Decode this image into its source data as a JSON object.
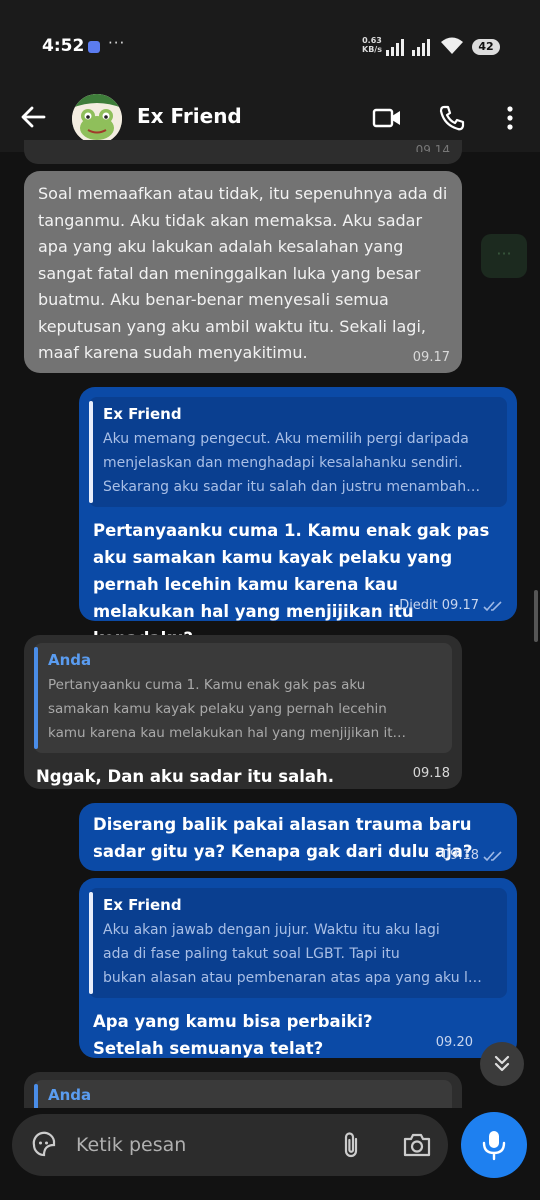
{
  "status_bar": {
    "time": "4:52",
    "more": "···",
    "net_speed_value": "0.63",
    "net_speed_unit": "KB/s",
    "battery": "42"
  },
  "header": {
    "contact_name": "Ex Friend"
  },
  "messages": {
    "top_partial_time": "09.14",
    "m1": {
      "text": "Soal memaafkan atau tidak, itu sepenuhnya ada di tanganmu. Aku tidak akan memaksa. Aku sadar apa yang aku lakukan adalah kesalahan yang sangat fatal dan meninggalkan luka yang besar buatmu. Aku benar-benar menyesali semua keputusan yang aku ambil waktu itu. Sekali lagi, maaf karena sudah menyakitimu.",
      "time": "09.17"
    },
    "m2": {
      "quote_name": "Ex Friend",
      "quote_lines": [
        "Aku memang pengecut. Aku memilih pergi daripada",
        "menjelaskan dan menghadapi kesalahanku sendiri.",
        "Sekarang aku sadar itu salah dan justru menambah…"
      ],
      "text": "Pertanyaanku cuma 1. Kamu enak gak pas aku samakan kamu kayak pelaku yang pernah lecehin kamu karena kau melakukan hal yang menjijikan itu kepadaku?",
      "edited": "Diedit",
      "time": "09.17"
    },
    "m3": {
      "quote_name": "Anda",
      "quote_lines": [
        "Pertanyaanku cuma 1. Kamu enak gak pas aku",
        "samakan kamu kayak pelaku yang pernah lecehin",
        "kamu karena kau melakukan hal yang menjijikan it…"
      ],
      "text": "Nggak, Dan aku sadar itu salah.",
      "time": "09.18"
    },
    "m4": {
      "text": "Diserang balik pakai alasan trauma baru sadar gitu ya? Kenapa gak dari dulu aja?",
      "time": "09.18"
    },
    "m5": {
      "quote_name": "Ex Friend",
      "quote_lines": [
        "Aku akan jawab dengan jujur. Waktu itu aku lagi",
        "ada di fase paling takut soal LGBT. Tapi itu",
        "bukan alasan atau pembenaran atas apa yang aku l…"
      ],
      "text": "Apa yang kamu bisa perbaiki? Setelah semuanya telat?",
      "time": "09.20"
    },
    "m6": {
      "quote_name": "Anda"
    }
  },
  "side_pill": "···",
  "composer": {
    "placeholder": "Ketik pesan"
  },
  "colors": {
    "outgoing": "#0b4aa6",
    "incoming": "#2d2d2d",
    "accent": "#1e80f0"
  }
}
